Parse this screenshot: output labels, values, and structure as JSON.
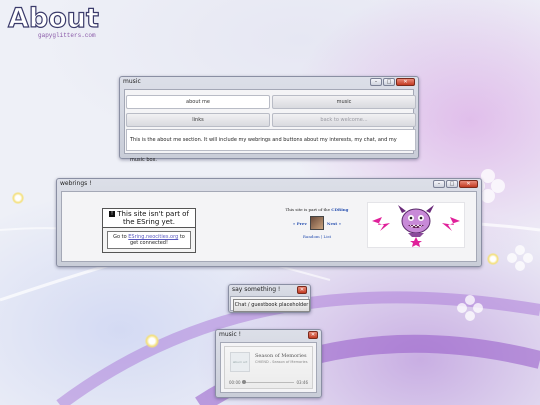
{
  "logo": {
    "title": "About",
    "subtitle": "gapyglitters.com"
  },
  "music_window": {
    "title": "music",
    "tabs": [
      {
        "label": "about me",
        "active": true
      },
      {
        "label": "music",
        "active": false
      },
      {
        "label": "links",
        "active": false
      },
      {
        "label": "back to welcome...",
        "disabled": true
      }
    ],
    "content": "This is the about me section. It will include my webrings and buttons about my interests, my chat, and my music box."
  },
  "webrings_window": {
    "title": "webrings !",
    "notice_title": "This site isn't part of the ESring yet.",
    "notice_body_prefix": "Go to ",
    "notice_link": "ESring.neocities.org",
    "notice_body_suffix": " to get connected!",
    "ring_text": "This site is part of the ",
    "ring_name": "CDRing",
    "prev": "« Prev",
    "next": "Next »",
    "random": "Random",
    "list": "List",
    "ring_sep": " | "
  },
  "chat_window": {
    "title": "say something !",
    "button_label": "Chat / guestbook placeholder"
  },
  "player_window": {
    "title": "music !",
    "art_label": "album art",
    "song": "Season of Memories",
    "artist": "CHIEND - Season of Memories",
    "time_current": "00:00",
    "time_total": "03:46",
    "progress": 0
  },
  "window_buttons": {
    "minimize": "–",
    "maximize": "□",
    "close": "✕"
  },
  "colors": {
    "accent": "#c23b22",
    "link": "#2850b0",
    "wallpaper": "#eef0f7"
  }
}
